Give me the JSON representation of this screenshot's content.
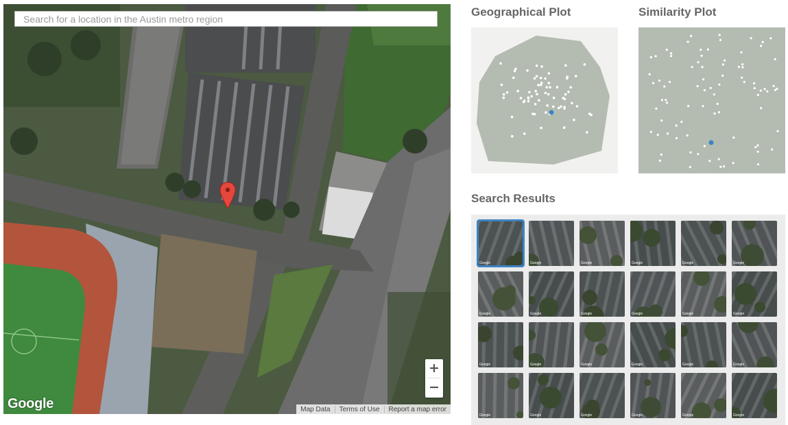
{
  "map": {
    "search": {
      "placeholder": "Search for a location in the Austin metro region",
      "value": ""
    },
    "zoom": {
      "in_label": "+",
      "out_label": "−"
    },
    "logo_text": "Google",
    "attribution": [
      "Map Data",
      "Terms of Use",
      "Report a map error"
    ],
    "marker_color": "#e5473c"
  },
  "geo_plot": {
    "title": "Geographical Plot",
    "region_color": "#b4bcb1",
    "point_color": "#ffffff",
    "highlight_color": "#3b84c4"
  },
  "sim_plot": {
    "title": "Similarity Plot",
    "bg_color": "#b4bcb1",
    "point_color": "#ffffff",
    "highlight_color": "#3b84c4"
  },
  "results": {
    "title": "Search Results",
    "rows": 4,
    "cols": 6,
    "selected_index": 0,
    "thumb_label": "Google"
  }
}
